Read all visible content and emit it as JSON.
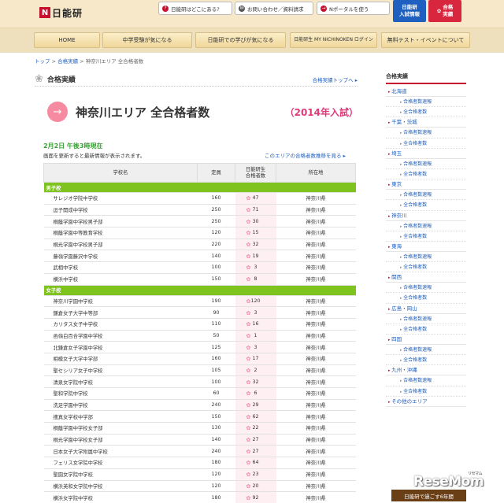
{
  "header": {
    "logo_text": "日能研",
    "links": [
      "日能研はどこにある?",
      "お問い合わせ／資料請求",
      "Nポータルを使う"
    ],
    "blue_btn": [
      "日能研",
      "入試情報"
    ],
    "red_btn": [
      "合格",
      "実績"
    ]
  },
  "nav": [
    "HOME",
    "中学受験が気になる",
    "日能研での学びが気になる",
    "日能研生 MY NICHINOKEN ログイン",
    "無料テスト・イベントについて"
  ],
  "breadcrumb": {
    "items": [
      "トップ",
      "合格実績",
      "神奈川エリア 全合格者数"
    ],
    "sep": " > "
  },
  "section": {
    "label": "合格実績",
    "top_link": "合格実績トップへ ▸"
  },
  "hero": {
    "title": "神奈川エリア 全合格者数",
    "year": "（2014年入試）"
  },
  "update": {
    "time": "2月2日 午後3時現在",
    "note": "画面を更新すると最新情報が表示されます。",
    "view_link": "このエリアの合格者数推移を見る ▸"
  },
  "table": {
    "headers": [
      "学校名",
      "定員",
      "日能研生\n合格者数",
      "所在地"
    ],
    "groups": [
      {
        "label": "男子校",
        "rows": [
          [
            "サレジオ学院中学校",
            "160",
            "47",
            "神奈川県"
          ],
          [
            "逗子開成中学校",
            "250",
            "71",
            "神奈川県"
          ],
          [
            "桐蔭学園中学校男子部",
            "250",
            "30",
            "神奈川県"
          ],
          [
            "桐蔭学園中等教育学校",
            "120",
            "15",
            "神奈川県"
          ],
          [
            "桐光学園中学校男子部",
            "220",
            "32",
            "神奈川県"
          ],
          [
            "藤嶺学園藤沢中学校",
            "140",
            "19",
            "神奈川県"
          ],
          [
            "武相中学校",
            "100",
            "3",
            "神奈川県"
          ],
          [
            "横浜中学校",
            "150",
            "8",
            "神奈川県"
          ]
        ]
      },
      {
        "label": "女子校",
        "rows": [
          [
            "神奈川学園中学校",
            "190",
            "120",
            "神奈川県"
          ],
          [
            "鎌倉女子大学中等部",
            "90",
            "3",
            "神奈川県"
          ],
          [
            "カリタス女子中学校",
            "110",
            "16",
            "神奈川県"
          ],
          [
            "函嶺白百合学園中学校",
            "50",
            "1",
            "神奈川県"
          ],
          [
            "北鎌倉女子学園中学校",
            "125",
            "3",
            "神奈川県"
          ],
          [
            "相模女子大学中学部",
            "160",
            "17",
            "神奈川県"
          ],
          [
            "聖セシリア女子中学校",
            "105",
            "2",
            "神奈川県"
          ],
          [
            "清泉女学院中学校",
            "100",
            "32",
            "神奈川県"
          ],
          [
            "聖和学院中学校",
            "60",
            "6",
            "神奈川県"
          ],
          [
            "洗足学園中学校",
            "240",
            "29",
            "神奈川県"
          ],
          [
            "捜真女学校中学部",
            "150",
            "62",
            "神奈川県"
          ],
          [
            "桐蔭学園中学校女子部",
            "130",
            "22",
            "神奈川県"
          ],
          [
            "桐光学園中学校女子部",
            "140",
            "27",
            "神奈川県"
          ],
          [
            "日本女子大学附属中学校",
            "240",
            "27",
            "神奈川県"
          ],
          [
            "フェリス女学院中学校",
            "180",
            "64",
            "神奈川県"
          ],
          [
            "聖園女学院中学校",
            "120",
            "23",
            "神奈川県"
          ],
          [
            "横浜英和女学院中学校",
            "120",
            "20",
            "神奈川県"
          ],
          [
            "横浜女学院中学校",
            "180",
            "92",
            "神奈川県"
          ]
        ]
      }
    ]
  },
  "sidebar": {
    "title": "合格実績",
    "regions": [
      {
        "name": "北海道",
        "subs": [
          "合格者数速報",
          "全合格者数"
        ]
      },
      {
        "name": "千葉・茨城",
        "subs": [
          "合格者数速報",
          "全合格者数"
        ]
      },
      {
        "name": "埼玉",
        "subs": [
          "合格者数速報",
          "全合格者数"
        ]
      },
      {
        "name": "東京",
        "subs": [
          "合格者数速報",
          "全合格者数"
        ]
      },
      {
        "name": "神奈川",
        "subs": [
          "合格者数速報",
          "全合格者数"
        ]
      },
      {
        "name": "東海",
        "subs": [
          "合格者数速報",
          "全合格者数"
        ]
      },
      {
        "name": "関西",
        "subs": [
          "合格者数速報",
          "全合格者数"
        ]
      },
      {
        "name": "広島・岡山",
        "subs": [
          "合格者数速報",
          "全合格者数"
        ]
      },
      {
        "name": "四国",
        "subs": [
          "合格者数速報",
          "全合格者数"
        ]
      },
      {
        "name": "九州・沖縄",
        "subs": [
          "合格者数速報",
          "全合格者数"
        ]
      },
      {
        "name": "その他のエリア",
        "subs": []
      }
    ],
    "banner": "日能研で過ごす6年間"
  },
  "watermark": {
    "text": "ReseMom",
    "sub": "リセマム"
  }
}
